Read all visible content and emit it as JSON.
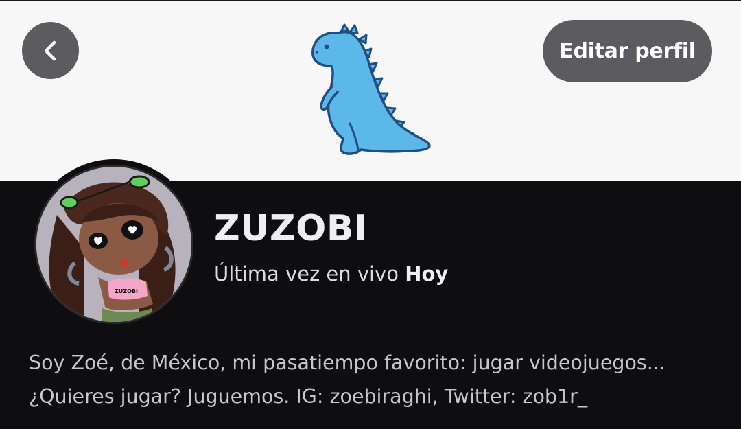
{
  "header": {
    "back_icon": "chevron-left-icon",
    "edit_profile_label": "Editar perfil",
    "banner_image": "blue-dinosaur-illustration"
  },
  "profile": {
    "display_name": "ZUZOBI",
    "last_live_prefix": "Última vez en vivo",
    "last_live_value": "Hoy",
    "avatar_badge_text": "ZUZOBI",
    "bio": [
      "Soy Zoé, de México, mi pasatiempo favorito: jugar videojuegos...",
      "¿Quieres jugar? Juguemos.  IG: zoebiraghi, Twitter: zob1r_"
    ]
  },
  "colors": {
    "banner_bg": "#f7f7f8",
    "page_bg": "#0e0e10",
    "button_bg": "#5c5c60",
    "dino_fill": "#5bb8e8",
    "dino_stroke": "#1f4f86"
  }
}
